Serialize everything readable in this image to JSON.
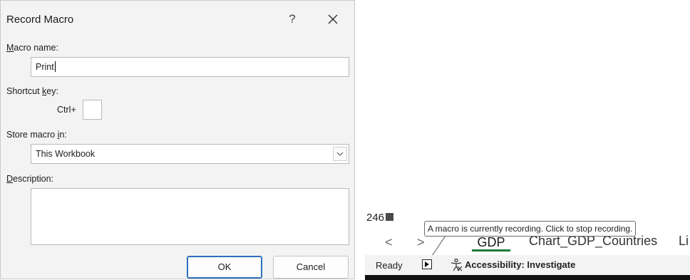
{
  "dialog": {
    "title": "Record Macro",
    "help_label": "?",
    "macro_name": {
      "label_underline": "M",
      "label_rest": "acro name:",
      "value": "Print"
    },
    "shortcut": {
      "label_pre": "Shortcut ",
      "label_underline": "k",
      "label_post": "ey:",
      "prefix": "Ctrl+",
      "value": ""
    },
    "store": {
      "label_pre": "Store macro ",
      "label_underline": "i",
      "label_post": "n:",
      "selected": "This Workbook"
    },
    "description": {
      "label_underline": "D",
      "label_rest": "escription:",
      "value": ""
    },
    "ok_label": "OK",
    "cancel_label": "Cancel"
  },
  "excel": {
    "cell_text": "246",
    "tabs": {
      "prev": "<",
      "next": ">",
      "active_tab": "GDP",
      "chart_tab": "Chart_GDP_Countries",
      "partial_tab": "Li"
    },
    "tooltip": "A macro is currently recording. Click to stop recording.",
    "status": {
      "ready": "Ready",
      "accessibility": "Accessibility: Investigate"
    }
  }
}
